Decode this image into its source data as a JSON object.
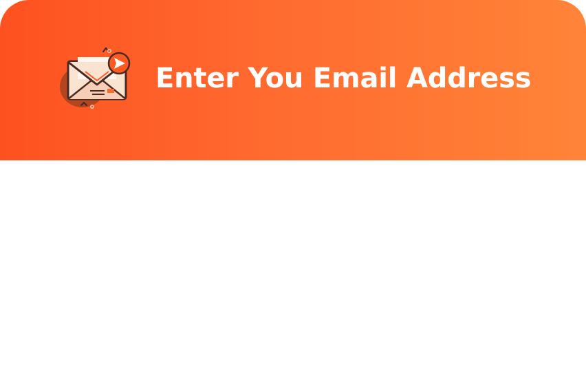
{
  "header": {
    "title": "Enter You Email Address",
    "icon": "email-envelope-send-icon"
  },
  "colors": {
    "gradient_start": "#fe5120",
    "gradient_end": "#ff8438",
    "title_text": "#ffffff"
  }
}
